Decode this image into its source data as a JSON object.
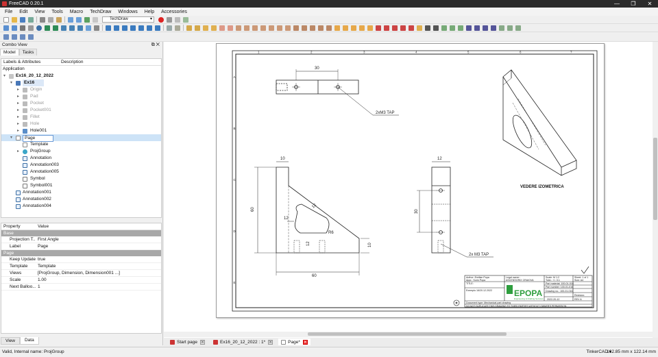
{
  "window": {
    "title": "FreeCAD 0.20.1",
    "controls": [
      "—",
      "❐",
      "✕"
    ]
  },
  "menu": [
    "File",
    "Edit",
    "View",
    "Tools",
    "Macro",
    "TechDraw",
    "Windows",
    "Help",
    "Accessories"
  ],
  "toolbar": {
    "workbench": "TechDraw"
  },
  "combo": {
    "title": "Combo View",
    "tabs": [
      "Model",
      "Tasks"
    ],
    "tree_columns": [
      "Labels & Attributes",
      "Description"
    ],
    "tree": [
      {
        "label": "Application"
      },
      {
        "label": "Ex16_20_12_2022"
      },
      {
        "label": "Ex16"
      },
      {
        "label": "Origin"
      },
      {
        "label": "Pad"
      },
      {
        "label": "Pocket"
      },
      {
        "label": "Pocket001"
      },
      {
        "label": "Fillet"
      },
      {
        "label": "Hole"
      },
      {
        "label": "Hole001"
      },
      {
        "label": "Page"
      },
      {
        "label": "Template"
      },
      {
        "label": "ProjGroup"
      },
      {
        "label": "Annotation"
      },
      {
        "label": "Annotation003"
      },
      {
        "label": "Annotation005"
      },
      {
        "label": "Symbol"
      },
      {
        "label": "Symbol001"
      },
      {
        "label": "Annotation001"
      },
      {
        "label": "Annotation002"
      },
      {
        "label": "Annotation004"
      }
    ],
    "props_header": [
      "Property",
      "Value"
    ],
    "group_base": "Base",
    "group_page": "Page",
    "props_base": [
      {
        "k": "Projection T...",
        "v": "First Angle"
      },
      {
        "k": "Label",
        "v": "Page"
      }
    ],
    "props_page": [
      {
        "k": "Keep Updated",
        "v": "true"
      },
      {
        "k": "Template",
        "v": "Template"
      },
      {
        "k": "Views",
        "v": "[ProjGroup, Dimension, Dimension001 ...]"
      },
      {
        "k": "Scale",
        "v": "1.00"
      },
      {
        "k": "Next Balloo...",
        "v": "1"
      }
    ],
    "bottom_tabs": [
      "View",
      "Data"
    ]
  },
  "drawing": {
    "dims": {
      "top_len": "30",
      "tap1": "2xM3 TAP",
      "w10": "10",
      "h60": "60",
      "h12": "12",
      "r12": "12",
      "r6": "R6",
      "d12": "12",
      "d10": "10",
      "w60": "60",
      "s12": "12",
      "s30": "30",
      "tap2": "2x M3 TAP"
    },
    "iso_label": "VEDERE IZOMETRICA",
    "zones_top": [
      "1",
      "2",
      "3",
      "4",
      "5",
      "6",
      "7"
    ],
    "zones_side": [
      "A",
      "B",
      "C",
      "D",
      "E"
    ],
    "title_block": {
      "author": "Author: Emilian Popa",
      "appr": "Appr.: Sorin Popa",
      "legal": "Legal owner:",
      "owner": "ASCENSORIX CRAIOVA",
      "scale": "Scale: M 1:2",
      "tol": "Toler.: +/- 0.1",
      "sheet": "Sheet: 1 of 1",
      "size": "Size: A4",
      "title_lbl": "TITLE:",
      "title_val": "Exemplu 16/20.12.2022",
      "pmat": "Part material: 100-01-016",
      "pnum": "Part number: 100-01-016",
      "dnum": "Drawing no.: 100-01-016",
      "date": "2022-20-12",
      "rev_lbl": "Revision:",
      "rev": "REV A",
      "doctype": "Document type:  Mechanical part drawing",
      "brand": "EPOPA",
      "brand_sub": "Engineering & Drafting Services",
      "notice": "DO NOT DUPLICATE THIS DRAWING TO THIRD PARTIES WITHOUT OWNER'S PERMISSION"
    }
  },
  "doc_tabs": [
    "Start page",
    "Ex16_20_12_2022 : 1*",
    "Page*"
  ],
  "status": {
    "left": "Valid, Internal name: ProjGroup",
    "nav": "TinkerCAD ▾",
    "dims": "162.85 mm x 122.14 mm"
  },
  "colors": {
    "accent": "#0078d7",
    "brand_green": "#2e9e3e",
    "page_bg": "#ffffff",
    "workbench_bg": "#f0f0f0"
  }
}
